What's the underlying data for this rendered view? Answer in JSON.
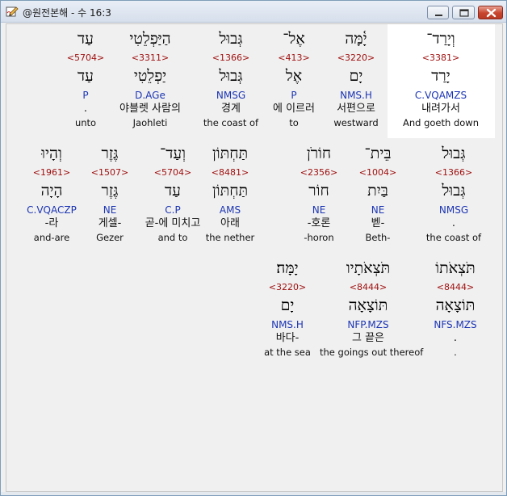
{
  "window": {
    "title": "@원전본해 - 수 16:3",
    "icon": "edit-app-icon",
    "controls": [
      "minimize-icon",
      "maximize-icon",
      "close-icon"
    ]
  },
  "rows": [
    {
      "words": [
        {
          "heb": "וְיָרַד־",
          "strong": "<3381>",
          "lemma": "יָרַד",
          "morph": "C.VQAMZS",
          "kor": "내려가서",
          "eng": "And goeth down",
          "highlighted": true
        },
        {
          "heb": "יָ֫מָּה",
          "strong": "<3220>",
          "lemma": "יָם",
          "morph": "NMS.H",
          "kor": "서편으로",
          "eng": "westward"
        },
        {
          "heb": "אֶל־",
          "strong": "<413>",
          "lemma": "אֶל",
          "morph": "P",
          "kor": "에 이르러",
          "eng": "to"
        },
        {
          "heb": "גְּבוּל",
          "strong": "<1366>",
          "lemma": "גְּבוּל",
          "morph": "NMSG",
          "kor": "경계",
          "eng": "the coast of"
        },
        {
          "heb": "הַיַּפְלֵטִי",
          "strong": "<3311>",
          "lemma": "יַפְלֵטִי",
          "morph": "D.AGe",
          "kor": "야블렛 사람의",
          "eng": "Jaohleti"
        },
        {
          "heb": "עַד",
          "strong": "<5704>",
          "lemma": "עַד",
          "morph": "P",
          "kor": ".",
          "eng": "unto"
        }
      ]
    },
    {
      "words": [
        {
          "heb": "גְּבוּל",
          "strong": "<1366>",
          "lemma": "גְּבוּל",
          "morph": "NMSG",
          "kor": ".",
          "eng": "the coast of"
        },
        {
          "heb": "בֵּית־",
          "strong": "<1004>",
          "lemma": "בַּיִת",
          "morph": "NE",
          "kor": "벧-",
          "eng": "Beth-"
        },
        {
          "heb": "חוֹרֹן",
          "strong": "<2356>",
          "lemma": "חוֹר",
          "morph": "NE",
          "kor": "-호론",
          "eng": "-horon"
        },
        {
          "heb": "תַּחְתּוֹן",
          "strong": "<8481>",
          "lemma": "תַּחְתּוֹן",
          "morph": "AMS",
          "kor": "아래",
          "eng": "the nether"
        },
        {
          "heb": "וְעַד־",
          "strong": "<5704>",
          "lemma": "עַד",
          "morph": "C.P",
          "kor": "곧-에 미치고",
          "eng": "and to"
        },
        {
          "heb": "גֶּזֶר",
          "strong": "<1507>",
          "lemma": "גֶּזֶר",
          "morph": "NE",
          "kor": "게셀-",
          "eng": "Gezer"
        },
        {
          "heb": "וְהָיוּ",
          "strong": "<1961>",
          "lemma": "הָיָה",
          "morph": "C.VQACZP",
          "kor": "-라",
          "eng": "and-are"
        }
      ]
    },
    {
      "words": [
        {
          "heb": "תֹּצְאֹתוֹ",
          "strong": "<8444>",
          "lemma": "תּוֹצָאָה",
          "morph": "NFS.MZS",
          "kor": ".",
          "eng": "."
        },
        {
          "heb": "תֹּצְאֹתָיו",
          "strong": "<8444>",
          "lemma": "תּוֹצָאָה",
          "morph": "NFP.MZS",
          "kor": "그 끝은",
          "eng": "the goings out thereof"
        },
        {
          "heb": "יָמָּה׃",
          "strong": "<3220>",
          "lemma": "יָם",
          "morph": "NMS.H",
          "kor": "바다-",
          "eng": "at the sea"
        }
      ]
    }
  ]
}
